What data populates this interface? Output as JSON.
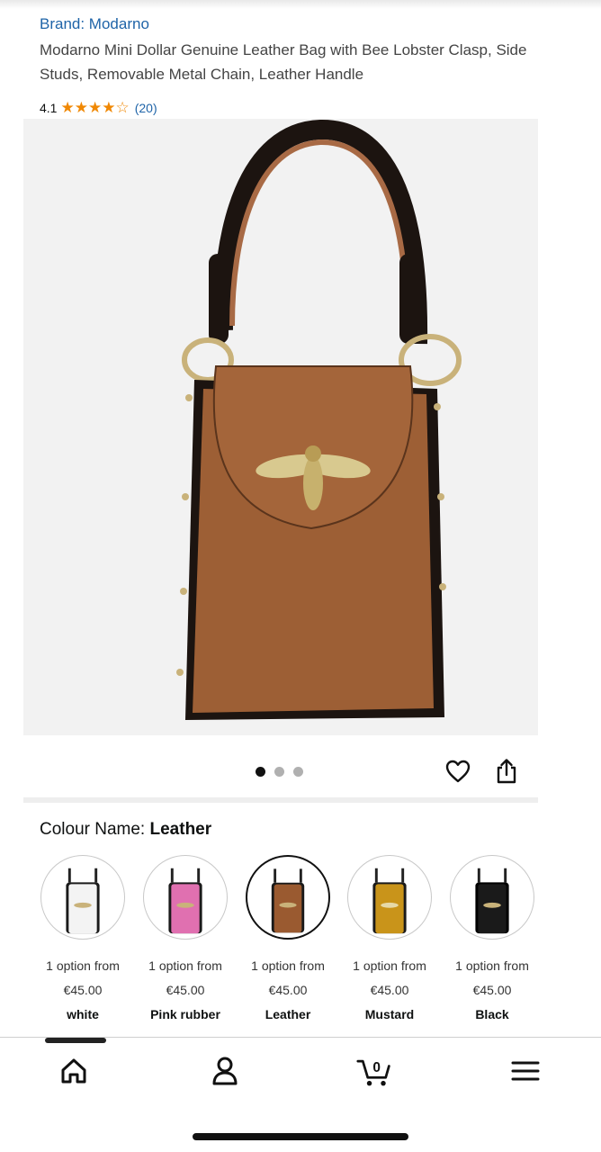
{
  "product": {
    "brand": "Brand: Modarno",
    "title": "Modarno Mini Dollar Genuine Leather Bag with Bee Lobster Clasp, Side Studs, Removable Metal Chain, Leather Handle",
    "rating": "4.1",
    "rating_value": 4.1,
    "review_count": "(20)",
    "star_color": "#f08804",
    "link_color": "#1f64a8"
  },
  "gallery": {
    "image_icon": "leather-bag-with-bee-clasp",
    "image_count": 3,
    "active_index": 0,
    "heart_icon": "heart-icon",
    "share_icon": "share-icon"
  },
  "colour": {
    "label": "Colour Name:",
    "selected": "Leather",
    "options": [
      {
        "opt": "1 option from",
        "price": "€45.00",
        "name": "white",
        "color": "#f3f3f3"
      },
      {
        "opt": "1 option from",
        "price": "€45.00",
        "name": "Pink rubber",
        "color": "#e070b0"
      },
      {
        "opt": "1 option from",
        "price": "€45.00",
        "name": "Leather",
        "color": "#9a5a30"
      },
      {
        "opt": "1 option from",
        "price": "€45.00",
        "name": "Mustard",
        "color": "#c9941a"
      },
      {
        "opt": "1 option from",
        "price": "€45.00",
        "name": "Black",
        "color": "#1a1a1a"
      }
    ]
  },
  "bottom_nav": {
    "items": [
      "home-icon",
      "account-icon",
      "cart-icon",
      "menu-icon"
    ],
    "cart_count": "0"
  }
}
